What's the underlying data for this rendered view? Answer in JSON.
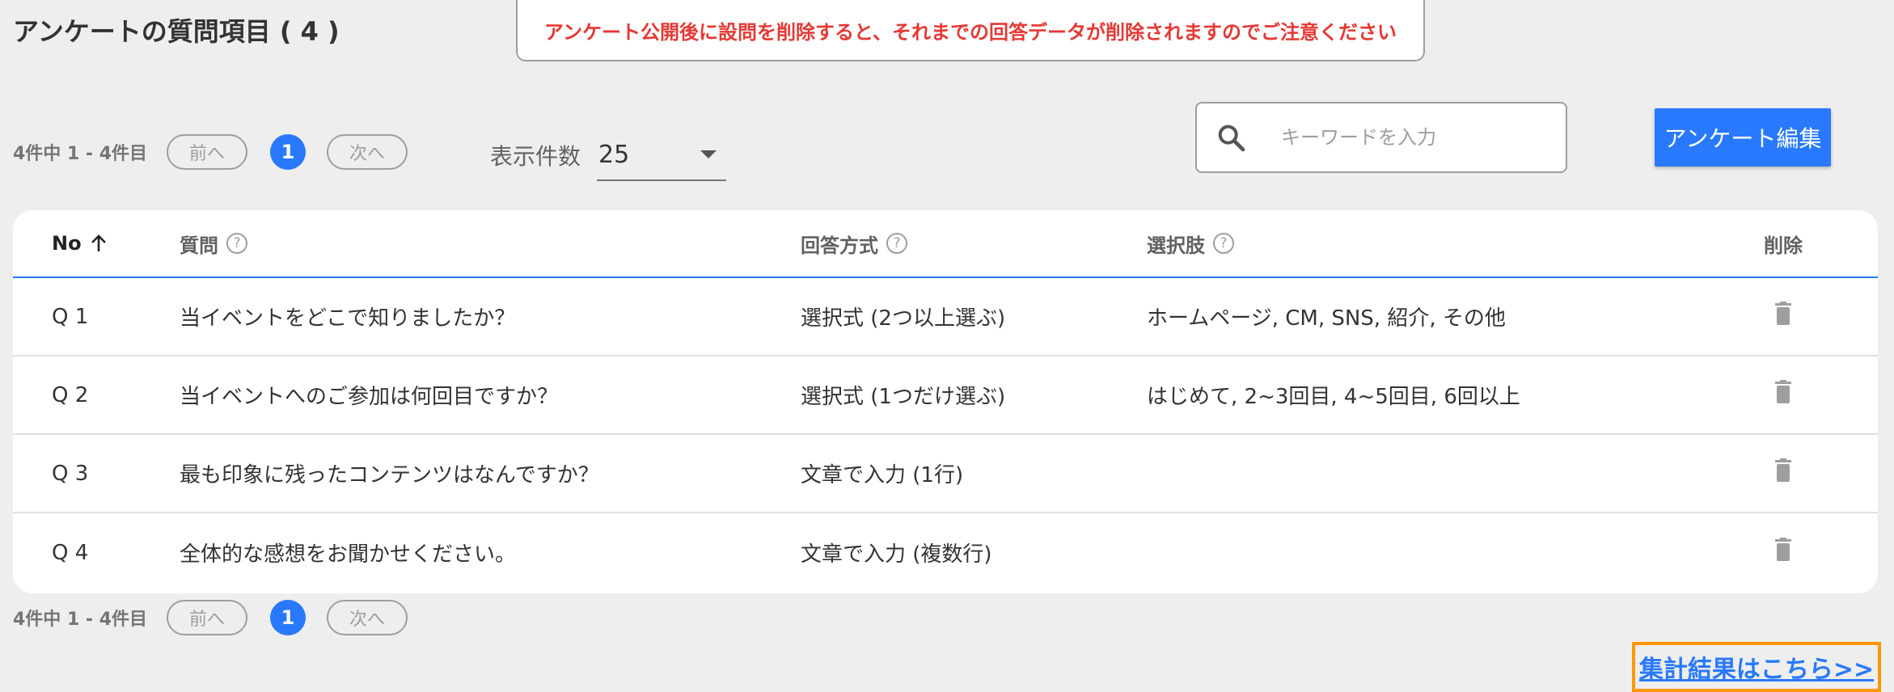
{
  "page": {
    "title": "アンケートの質問項目 ( 4 )",
    "warning": "アンケート公開後に設問を削除すると、それまでの回答データが削除されますのでご注意ください"
  },
  "pagination": {
    "count_text": "4件中 1 - 4件目",
    "prev_label": "前へ",
    "next_label": "次へ",
    "current_page": "1"
  },
  "per_page": {
    "label": "表示件数",
    "value": "25"
  },
  "search": {
    "placeholder": "キーワードを入力",
    "icon": "search-icon"
  },
  "toolbar": {
    "edit_label": "アンケート編集"
  },
  "table": {
    "headers": {
      "no": "No",
      "question": "質問",
      "answer_type": "回答方式",
      "options": "選択肢",
      "delete": "削除"
    },
    "help_glyph": "?",
    "rows": [
      {
        "no": "Q 1",
        "question": "当イベントをどこで知りましたか？",
        "answer_type": "選択式 (2つ以上選ぶ)",
        "options": "ホームページ, CM, SNS, 紹介, その他"
      },
      {
        "no": "Q 2",
        "question": "当イベントへのご参加は何回目ですか？",
        "answer_type": "選択式 (1つだけ選ぶ)",
        "options": "はじめて, 2~3回目, 4~5回目, 6回以上"
      },
      {
        "no": "Q 3",
        "question": "最も印象に残ったコンテンツはなんですか？",
        "answer_type": "文章で入力 (1行)",
        "options": ""
      },
      {
        "no": "Q 4",
        "question": "全体的な感想をお聞かせください。",
        "answer_type": "文章で入力 (複数行)",
        "options": ""
      }
    ]
  },
  "footer": {
    "results_link": "集計結果はこちら>>"
  },
  "colors": {
    "accent": "#2979ff",
    "warning": "#e53935",
    "highlight": "#ff9800"
  }
}
